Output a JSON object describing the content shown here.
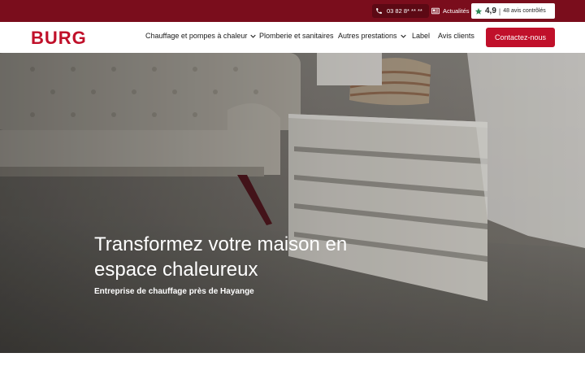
{
  "topbar": {
    "phone": "03 82 8* ** **",
    "news_label": "Actualités",
    "rating_score": "4,9",
    "rating_separator": "|",
    "rating_reviews": "48 avis contrôlés"
  },
  "nav": {
    "logo_text": "BURG",
    "items": [
      {
        "label": "Chauffage et pompes à chaleur",
        "dropdown": true
      },
      {
        "label": "Plomberie et sanitaires",
        "dropdown": false
      },
      {
        "label": "Autres prestations",
        "dropdown": true
      },
      {
        "label": "Label",
        "dropdown": false
      },
      {
        "label": "Avis clients",
        "dropdown": false
      }
    ],
    "cta_label": "Contactez-nous"
  },
  "hero": {
    "title": "Transformez votre maison en espace chaleureux",
    "subtitle": "Entreprise de chauffage près de Hayange"
  },
  "colors": {
    "brand": "#c0102a",
    "topbar": "#7a0d1c",
    "rating_star": "#2e8b57"
  }
}
